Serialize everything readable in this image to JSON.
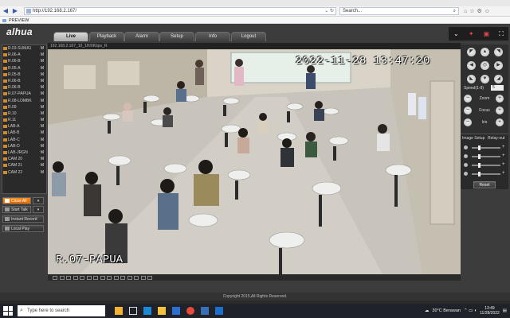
{
  "browser": {
    "url": "http://192.168.2.167/",
    "search_placeholder": "Search...",
    "tab_title": "PREVIEW"
  },
  "app": {
    "logo": "alhua",
    "menu": [
      "Live",
      "Playback",
      "Alarm",
      "Setup",
      "Info",
      "Logout"
    ],
    "active_menu": "Live"
  },
  "channels": [
    "R.03-SUMA1",
    "R.06-A",
    "R.06-B",
    "R.05-A",
    "R.05-B",
    "R.06-B",
    "R.06-B",
    "R.07-PAPUA",
    "R.08-LOMBK",
    "R.09",
    "R.10",
    "R.11",
    "LAB-A",
    "LAB-B",
    "LAB-C",
    "LAB-D",
    "LAB-JRGN",
    "CAM 20",
    "CAM 21",
    "CAM 22"
  ],
  "channel_marker": "M",
  "left_buttons": {
    "close_all": "Close All",
    "start_talk": "Start Talk",
    "instant_record": "Instant Record",
    "local_play": "Local Play"
  },
  "video": {
    "header": "192.168.2.167_10_1H/0Kbps_R",
    "timestamp": "2022-11-28 13:47:20",
    "camera_name": "R.07-PAPUA"
  },
  "ptz": {
    "speed_label": "Speed(1-8)",
    "speed_value": "5",
    "zoom_label": "Zoom",
    "focus_label": "Focus",
    "iris_label": "Iris"
  },
  "image_setup": {
    "title": "Image Setup",
    "relay_out": "Relay-out",
    "reset": "Reset"
  },
  "footer": "Copyright 2015,All Rights Reserved.",
  "taskbar": {
    "search_placeholder": "Type here to search",
    "weather": "30°C  Berawan",
    "time": "13:49",
    "date": "11/28/2022"
  }
}
